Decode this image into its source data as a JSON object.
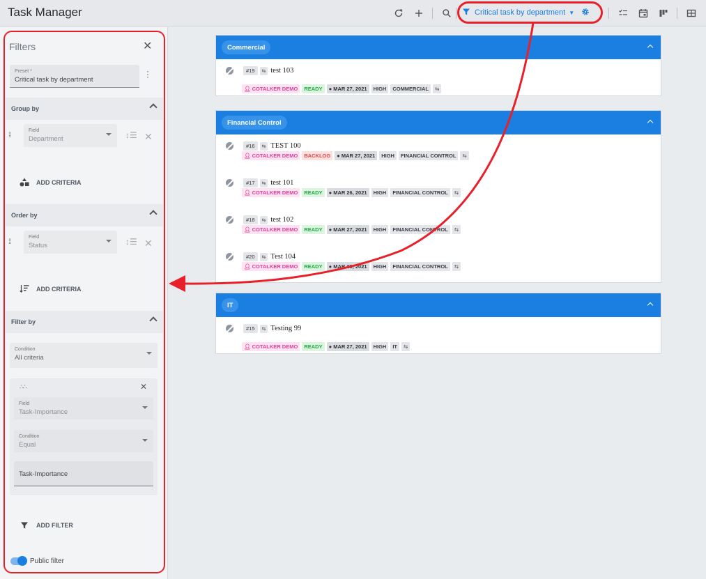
{
  "app": {
    "title": "Task Manager"
  },
  "toolbar": {
    "preset_label": "Critical task by department",
    "icons": [
      "refresh-icon",
      "plus-icon",
      "search-icon",
      "funnel-icon",
      "gear-icon",
      "checklist-icon",
      "calendar-icon",
      "kanban-icon",
      "table-icon"
    ]
  },
  "panel": {
    "title": "Filters",
    "preset": {
      "label": "Preset *",
      "value": "Critical task by department"
    },
    "group_by": {
      "title": "Group by",
      "field_label": "Field",
      "field_value": "Department",
      "add_label": "ADD CRITERIA"
    },
    "order_by": {
      "title": "Order by",
      "field_label": "Field",
      "field_value": "Status",
      "add_label": "ADD CRITERIA"
    },
    "filter_by": {
      "title": "Filter by",
      "condition_label": "Condition",
      "condition_value": "All criteria",
      "card": {
        "field_label": "Field",
        "field_value": "Task-Importance",
        "condition_label": "Condition",
        "condition_value": "Equal",
        "value": "Task-Importance"
      },
      "add_label": "ADD FILTER"
    },
    "public_label": "Public filter"
  },
  "groups": [
    {
      "name": "Commercial",
      "tasks": [
        {
          "num": "#19",
          "name": "test 103",
          "user": "COTALKER DEMO",
          "status": "READY",
          "date": "MAR 27, 2021",
          "priority": "HIGH",
          "dept": "COMMERCIAL"
        }
      ]
    },
    {
      "name": "Financial Control",
      "tasks": [
        {
          "num": "#16",
          "name": "TEST 100",
          "user": "COTALKER DEMO",
          "status": "BACKLOG",
          "date": "MAR 27, 2021",
          "priority": "HIGH",
          "dept": "FINANCIAL CONTROL"
        },
        {
          "num": "#17",
          "name": "test 101",
          "user": "COTALKER DEMO",
          "status": "READY",
          "date": "MAR 26, 2021",
          "priority": "HIGH",
          "dept": "FINANCIAL CONTROL"
        },
        {
          "num": "#18",
          "name": "test 102",
          "user": "COTALKER DEMO",
          "status": "READY",
          "date": "MAR 27, 2021",
          "priority": "HIGH",
          "dept": "FINANCIAL CONTROL"
        },
        {
          "num": "#20",
          "name": "Test 104",
          "user": "COTALKER DEMO",
          "status": "READY",
          "date": "MAR 29, 2021",
          "priority": "HIGH",
          "dept": "FINANCIAL CONTROL"
        }
      ]
    },
    {
      "name": "IT",
      "tasks": [
        {
          "num": "#15",
          "name": "Testing 99",
          "user": "COTALKER DEMO",
          "status": "READY",
          "date": "MAR 27, 2021",
          "priority": "HIGH",
          "dept": "IT"
        }
      ]
    }
  ],
  "colors": {
    "accent": "#1a7fe0",
    "annotation": "#e8202a"
  }
}
